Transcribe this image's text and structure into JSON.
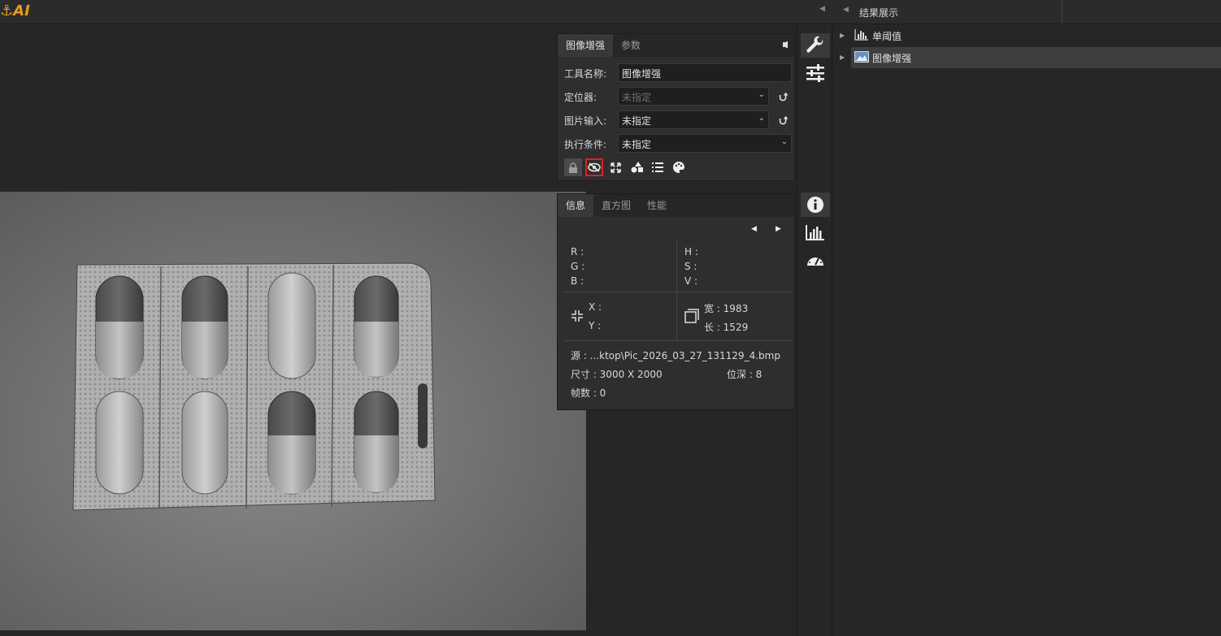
{
  "app": {
    "logo": "AI"
  },
  "tool_panel": {
    "tabs": [
      {
        "label": "图像增强",
        "active": true
      },
      {
        "label": "参数",
        "active": false
      }
    ],
    "fields": {
      "tool_name": {
        "label": "工具名称:",
        "value": "图像增强"
      },
      "locator": {
        "label": "定位器:",
        "value": "未指定"
      },
      "image_input": {
        "label": "图片输入:",
        "value": "未指定"
      },
      "exec_condition": {
        "label": "执行条件:",
        "value": "未指定"
      }
    },
    "icons": [
      "lock-icon",
      "eye-off-icon",
      "fit-screen-icon",
      "shapes-icon",
      "list-icon",
      "palette-icon"
    ]
  },
  "info_panel": {
    "tabs": [
      {
        "label": "信息",
        "active": true
      },
      {
        "label": "直方图",
        "active": false
      },
      {
        "label": "性能",
        "active": false
      }
    ],
    "rgb": {
      "r": "R :",
      "g": "G :",
      "b": "B :"
    },
    "hsv": {
      "h": "H :",
      "s": "S :",
      "v": "V :"
    },
    "xy": {
      "x": "X :",
      "y": "Y :"
    },
    "size": {
      "width": "宽 : 1983",
      "height": "长 : 1529"
    },
    "source": "源    : ...ktop\\Pic_2026_03_27_131129_4.bmp",
    "dimensions": "尺寸 : 3000 X 2000",
    "bit_depth": "位深 : 8",
    "frames": "帧数 : 0"
  },
  "results": {
    "title": "结果展示",
    "items": [
      {
        "label": "单阈值",
        "selected": false
      },
      {
        "label": "图像增强",
        "selected": true
      }
    ]
  },
  "colors": {
    "logo": "#e59b1f",
    "highlight": "#e02020",
    "background": "#262626",
    "panel": "#2e2e2e"
  }
}
